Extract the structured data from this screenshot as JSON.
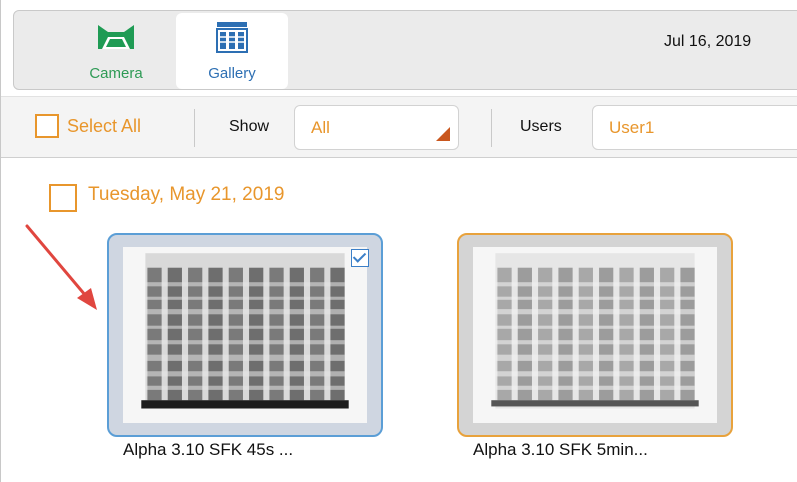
{
  "nav": {
    "camera_label": "Camera",
    "gallery_label": "Gallery",
    "date": "Jul 16, 2019"
  },
  "toolbar": {
    "select_all_label": "Select All",
    "show_label": "Show",
    "show_value": "All",
    "users_label": "Users",
    "users_value": "User1"
  },
  "group": {
    "date_label": "Tuesday, May 21, 2019"
  },
  "thumbnails": [
    {
      "caption": "Alpha 3.10 SFK 45s ...",
      "selected": true
    },
    {
      "caption": "Alpha 3.10 SFK 5min...",
      "selected": false
    }
  ],
  "colors": {
    "accent_orange": "#e8962c",
    "camera_green": "#2e9a55",
    "gallery_blue": "#2d6fb3",
    "annotation_red": "#e0463f"
  }
}
